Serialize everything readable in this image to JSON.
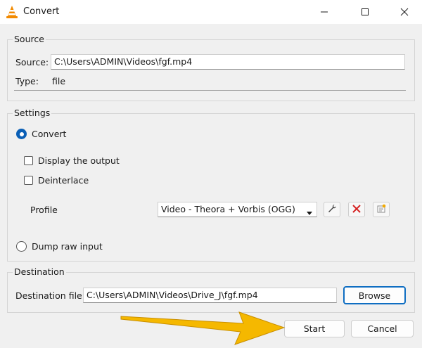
{
  "window": {
    "title": "Convert",
    "controls": [
      "minimize-icon",
      "maximize-icon",
      "close-icon"
    ]
  },
  "source": {
    "group_label": "Source",
    "source_label": "Source:",
    "source_value": "C:\\Users\\ADMIN\\Videos\\fgf.mp4",
    "type_label": "Type:",
    "type_value": "file"
  },
  "settings": {
    "group_label": "Settings",
    "convert_label": "Convert",
    "convert_selected": true,
    "display_output_label": "Display the output",
    "display_output_checked": false,
    "deinterlace_label": "Deinterlace",
    "deinterlace_checked": false,
    "profile_label": "Profile",
    "profile_value": "Video - Theora + Vorbis (OGG)",
    "profile_icons": [
      "wrench-icon",
      "delete-icon",
      "new-profile-icon"
    ],
    "dump_raw_label": "Dump raw input",
    "dump_raw_selected": false
  },
  "destination": {
    "group_label": "Destination",
    "file_label": "Destination file:",
    "file_value": "C:\\Users\\ADMIN\\Videos\\Drive_J\\fgf.mp4",
    "browse_label": "Browse"
  },
  "actions": {
    "start_label": "Start",
    "cancel_label": "Cancel"
  },
  "colors": {
    "accent": "#0a5fb6",
    "annotation_arrow": "#f5b800",
    "delete_red": "#d42020"
  }
}
